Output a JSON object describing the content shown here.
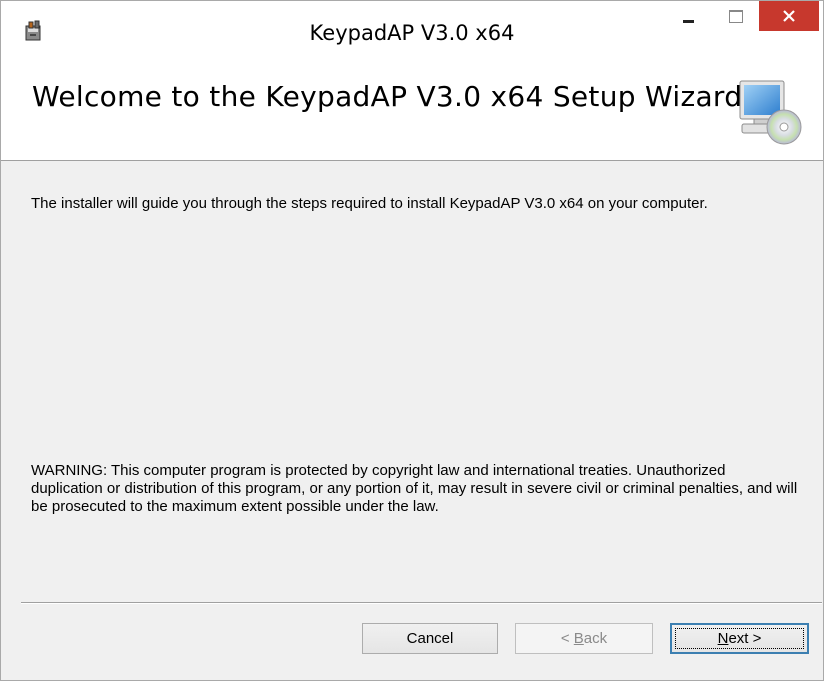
{
  "window": {
    "title": "KeypadAP V3.0 x64",
    "controls": [
      "minimize-icon",
      "maximize-icon",
      "close-icon"
    ]
  },
  "banner": {
    "title": "Welcome to the KeypadAP V3.0 x64 Setup Wizard",
    "icon": "computer-cd-icon"
  },
  "body": {
    "intro": "The installer will guide you through the steps required to install KeypadAP V3.0 x64 on your computer.",
    "warning": "WARNING: This computer program is protected by copyright law and international treaties. Unauthorized duplication or distribution of this program, or any portion of it, may result in severe civil or criminal penalties, and will be prosecuted to the maximum extent possible under the law."
  },
  "buttons": {
    "cancel": "Cancel",
    "back_prefix": "< ",
    "back_mnemonic": "B",
    "back_rest": "ack",
    "next_mnemonic": "N",
    "next_rest": "ext >"
  },
  "colors": {
    "close_button": "#c7382d",
    "focus_border": "#3c7fb1",
    "dialog_background": "#f0f0f0"
  }
}
